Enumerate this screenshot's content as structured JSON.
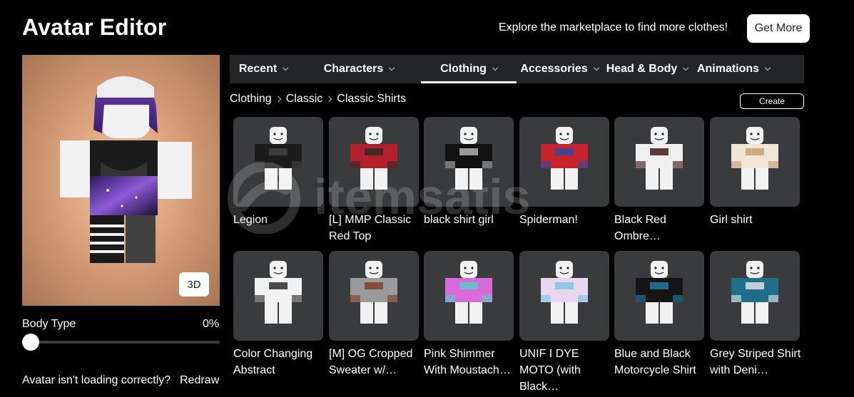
{
  "header": {
    "title": "Avatar Editor",
    "explore_text": "Explore the marketplace to find more clothes!",
    "get_more_label": "Get More"
  },
  "preview": {
    "btn_3d_label": "3D",
    "body_type_label": "Body Type",
    "body_type_value": "0%",
    "body_type_fraction": 0,
    "loading_text": "Avatar isn't loading correctly?",
    "redraw_label": "Redraw"
  },
  "tabs": [
    {
      "label": "Recent",
      "active": false
    },
    {
      "label": "Characters",
      "active": false
    },
    {
      "label": "Clothing",
      "active": true
    },
    {
      "label": "Accessories",
      "active": false
    },
    {
      "label": "Head & Body",
      "active": false
    },
    {
      "label": "Animations",
      "active": false
    }
  ],
  "breadcrumb": [
    "Clothing",
    "Classic",
    "Classic Shirts"
  ],
  "create_label": "Create",
  "items": [
    {
      "name": "Legion",
      "shirt": "#1b1b1b",
      "accent": "#444444"
    },
    {
      "name": "[L] MMP Classic Red Top",
      "shirt": "#b3202a",
      "accent": "#2a2a2a"
    },
    {
      "name": "black shirt girl",
      "shirt": "#111111",
      "accent": "#bbbbbb"
    },
    {
      "name": "Spiderman!",
      "shirt": "#c8232b",
      "accent": "#1f4fa8"
    },
    {
      "name": "Black Red Ombre…",
      "shirt": "#f0f0f0",
      "accent": "#3a0d10"
    },
    {
      "name": "Girl shirt",
      "shirt": "#efe6d6",
      "accent": "#c79a6b"
    },
    {
      "name": "Color Changing Abstract",
      "shirt": "#f2f2f2",
      "accent": "#222222"
    },
    {
      "name": "[M] OG Cropped Sweater w/…",
      "shirt": "#9a9a9a",
      "accent": "#7a3b1d"
    },
    {
      "name": "Pink Shimmer With Moustach…",
      "shirt": "#d66bd9",
      "accent": "#4fd0c2"
    },
    {
      "name": "UNIF I DYE MOTO (with Black…",
      "shirt": "#e9d7f0",
      "accent": "#7ac3e6"
    },
    {
      "name": "Blue and Black Motorcycle Shirt",
      "shirt": "#151515",
      "accent": "#1f7fa6"
    },
    {
      "name": "Grey Striped Shirt with Deni…",
      "shirt": "#1f6f8a",
      "accent": "#e8e8e8"
    }
  ],
  "watermark_text": "itemsatis",
  "colors": {
    "background": "#000000",
    "tab_bar": "#232527",
    "card": "#393b3d",
    "active_underline": "#ffffff"
  }
}
